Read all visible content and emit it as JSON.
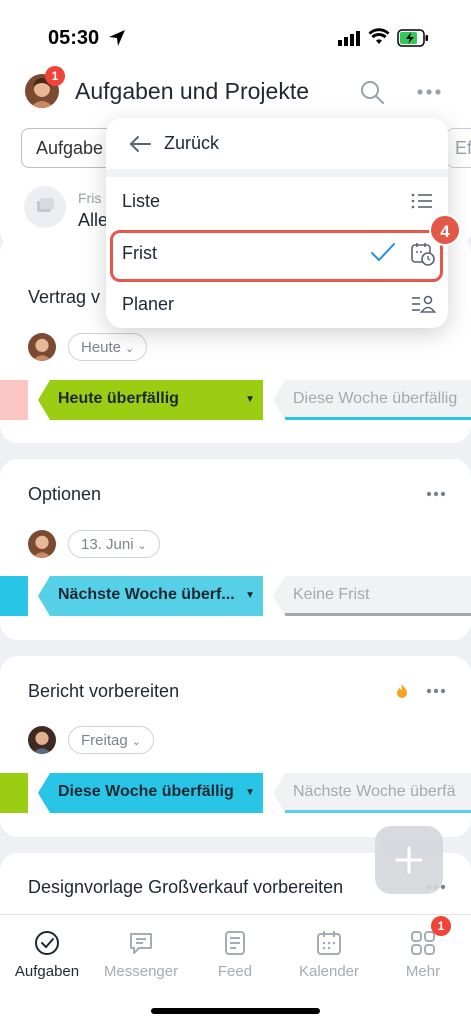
{
  "status": {
    "time": "05:30"
  },
  "header": {
    "title": "Aufgaben und Projekte",
    "avatar_badge": "1"
  },
  "filter": {
    "chip_label": "Aufgabe",
    "chip2_label": "Ef"
  },
  "deadline": {
    "label": "Fris",
    "value": "Alle"
  },
  "dropdown": {
    "back_label": "Zurück",
    "items": [
      {
        "label": "Liste",
        "icon": "list-icon"
      },
      {
        "label": "Frist",
        "icon": "calendar-clock-icon",
        "selected": true
      },
      {
        "label": "Planer",
        "icon": "planner-icon"
      }
    ],
    "step_badge": "4"
  },
  "tasks": [
    {
      "title": "Vertrag v",
      "date": "Heute",
      "stage": "Heute überfällig",
      "next_stage": "Diese Woche überfällig",
      "hot": false
    },
    {
      "title": "Optionen",
      "date": "13. Juni",
      "stage": "Nächste Woche überf...",
      "next_stage": "Keine Frist",
      "hot": false
    },
    {
      "title": "Bericht vorbereiten",
      "date": "Freitag",
      "stage": "Diese Woche überfällig",
      "next_stage": "Nächste Woche überfä",
      "hot": true
    },
    {
      "title": "Designvorlage Großverkauf vorbereiten"
    }
  ],
  "tabs": [
    {
      "label": "Aufgaben",
      "icon": "check-circle-icon",
      "active": true
    },
    {
      "label": "Messenger",
      "icon": "chat-icon"
    },
    {
      "label": "Feed",
      "icon": "feed-icon"
    },
    {
      "label": "Kalender",
      "icon": "calendar-icon"
    },
    {
      "label": "Mehr",
      "icon": "grid-icon",
      "badge": "1"
    }
  ],
  "colors": {
    "accent_red": "#e4584a",
    "green": "#9bcd12",
    "cyan": "#29c5e6",
    "badge_red": "#f0443b"
  }
}
